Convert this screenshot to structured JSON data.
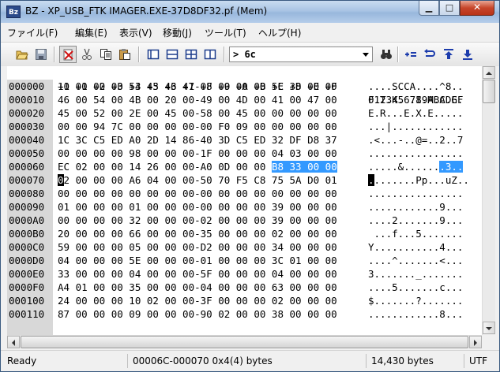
{
  "window": {
    "title": "BZ - XP_USB_FTK IMAGER.EXE-37D8DF32.pf (Mem)",
    "app_icon_text": "Bz",
    "minimize_glyph": "▁",
    "maximize_glyph": "□",
    "close_glyph": "✕"
  },
  "menu": [
    "ファイル(F)",
    "編集(E)",
    "表示(V)",
    "移動(J)",
    "ツール(T)",
    "ヘルプ(H)"
  ],
  "toolbar": {
    "search_value": "> 6c",
    "icons": [
      "open-folder-icon",
      "save-icon",
      "cut-mark-icon",
      "scissors-icon",
      "copy-icon",
      "paste-icon",
      "view-1-icon",
      "view-2-icon",
      "view-3-icon",
      "view-4-icon",
      "binoculars-icon",
      "find-equals-icon",
      "undo-jump-icon",
      "jump-up-icon",
      "jump-down-icon"
    ]
  },
  "hex_view": {
    "header_hex": "+0 +1 +2 +3 +4 +5 +6 +7 +8 +9 +A +B +C +D +E +F",
    "header_ascii": "0123456789ABCDEF",
    "rows": [
      {
        "addr": "000000",
        "hex": "11 00 00 00 53 43 43 41-0F 00 00 00 5E 38 00 00",
        "ascii": "....SCCA....^8.."
      },
      {
        "addr": "000010",
        "hex": "46 00 54 00 4B 00 20 00-49 00 4D 00 41 00 47 00",
        "ascii": "F.T.K. .I.M.A.G."
      },
      {
        "addr": "000020",
        "hex": "45 00 52 00 2E 00 45 00-58 00 45 00 00 00 00 00",
        "ascii": "E.R...E.X.E....."
      },
      {
        "addr": "000030",
        "hex": "00 00 94 7C 00 00 00 00-00 F0 09 00 00 00 00 00",
        "ascii": "...|............"
      },
      {
        "addr": "000040",
        "hex": "1C 3C C5 ED A0 2D 14 86-40 3D C5 ED 32 DF D8 37",
        "ascii": ".<...-..@=..2..7"
      },
      {
        "addr": "000050",
        "hex": "00 00 00 00 98 00 00 00-1F 00 00 00 04 03 00 00",
        "ascii": "................"
      },
      {
        "addr": "000060",
        "hex_pre": "EC 02 00 00 14 26 00 00-A0 0D 00 00 ",
        "hex_hl": "B8 33 00 00",
        "ascii_pre": ".....&......",
        "ascii_hl": ".3.."
      },
      {
        "addr": "000070",
        "hex_cur": "0",
        "hex_post": "2 00 00 00 A6 04 00 00-50 70 F5 C8 75 5A D0 01",
        "ascii_cur": ".",
        "ascii_post": ".......Pp...uZ.."
      },
      {
        "addr": "000080",
        "hex": "00 00 00 00 00 00 00 00-00 00 00 00 00 00 00 00",
        "ascii": "................"
      },
      {
        "addr": "000090",
        "hex": "01 00 00 00 01 00 00 00-00 00 00 00 39 00 00 00",
        "ascii": "............9..."
      },
      {
        "addr": "0000A0",
        "hex": "00 00 00 00 32 00 00 00-02 00 00 00 39 00 00 00",
        "ascii": "....2.......9..."
      },
      {
        "addr": "0000B0",
        "hex": "20 00 00 00 66 00 00 00-35 00 00 00 02 00 00 00",
        "ascii": " ...f...5......."
      },
      {
        "addr": "0000C0",
        "hex": "59 00 00 00 05 00 00 00-D2 00 00 00 34 00 00 00",
        "ascii": "Y...........4..."
      },
      {
        "addr": "0000D0",
        "hex": "04 00 00 00 5E 00 00 00-01 00 00 00 3C 01 00 00",
        "ascii": "....^.......<..."
      },
      {
        "addr": "0000E0",
        "hex": "33 00 00 00 04 00 00 00-5F 00 00 00 04 00 00 00",
        "ascii": "3......._......."
      },
      {
        "addr": "0000F0",
        "hex": "A4 01 00 00 35 00 00 00-04 00 00 00 63 00 00 00",
        "ascii": "....5.......c..."
      },
      {
        "addr": "000100",
        "hex": "24 00 00 00 10 02 00 00-3F 00 00 00 02 00 00 00",
        "ascii": "$.......?......."
      },
      {
        "addr": "000110",
        "hex": "87 00 00 00 09 00 00 00-90 02 00 00 38 00 00 00",
        "ascii": "............8..."
      }
    ]
  },
  "status": {
    "ready": "Ready",
    "selection": "00006C-000070 0x4(4) bytes",
    "size": "14,430 bytes",
    "encoding": "UTF"
  },
  "colors": {
    "selection": "#3399ff",
    "address_bg": "#d8d8d8"
  }
}
